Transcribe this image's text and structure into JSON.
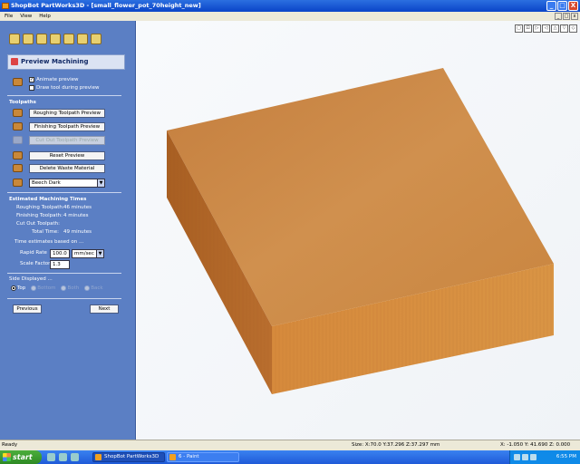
{
  "window": {
    "title": "ShopBot PartWorks3D - [small_flower_pot_70height_new]",
    "buttons": {
      "minimize": "_",
      "maximize": "□",
      "close": "X"
    }
  },
  "menu": {
    "items": [
      "File",
      "View",
      "Help"
    ]
  },
  "mdi": {
    "minimize": "_",
    "restore": "□",
    "close": "x"
  },
  "panel": {
    "header": "Preview Machining",
    "animate_preview": {
      "label": "Animate preview",
      "checked": true
    },
    "draw_tool": {
      "label": "Draw tool during preview",
      "checked": false
    },
    "toolpaths_heading": "Toolpaths",
    "roughing_button": "Roughing Toolpath Preview",
    "finishing_button": "Finishing Toolpath Preview",
    "cutout_button": "Cut Out Toolpath Preview",
    "reset_button": "Reset Preview",
    "delete_button": "Delete Waste Material",
    "material": "Beech Dark",
    "times_heading": "Estimated Machining Times",
    "times": [
      {
        "label": "Roughing Toolpath:",
        "value": "46 minutes"
      },
      {
        "label": "Finishing Toolpath:",
        "value": "4 minutes"
      },
      {
        "label": "Cut Out Toolpath:",
        "value": ""
      },
      {
        "label": "Total Time:",
        "value": "49 minutes"
      }
    ],
    "estimates_note": "Time estimates based on ...",
    "rapid_rate_label": "Rapid Rate",
    "rapid_rate_value": "100.0",
    "rapid_unit": "mm/sec",
    "scale_factor_label": "Scale Factor",
    "scale_factor_value": "1.3",
    "side_heading": "Side Displayed ...",
    "side_options": [
      "Top",
      "Bottom",
      "Both",
      "Back"
    ],
    "side_selected": "Top",
    "previous_button": "Previous",
    "next_button": "Next"
  },
  "viewport": {
    "tools": [
      "▢",
      "⊡",
      "▷",
      "◁",
      "△",
      "▽",
      "◇"
    ],
    "block_colors": {
      "top": "#cd8a46",
      "left": "#b66d2c",
      "right": "#d98a3d"
    }
  },
  "status": {
    "left": "Ready",
    "size": "Size: X:70.0 Y:37.296 Z:37.297 mm",
    "coords": "X: -1.050 Y: 41.690 Z: 0.000"
  },
  "taskbar": {
    "start_label": "start",
    "tasks": [
      "ShopBot PartWorks3D",
      "6 - Paint"
    ],
    "clock": "6:55 PM"
  }
}
